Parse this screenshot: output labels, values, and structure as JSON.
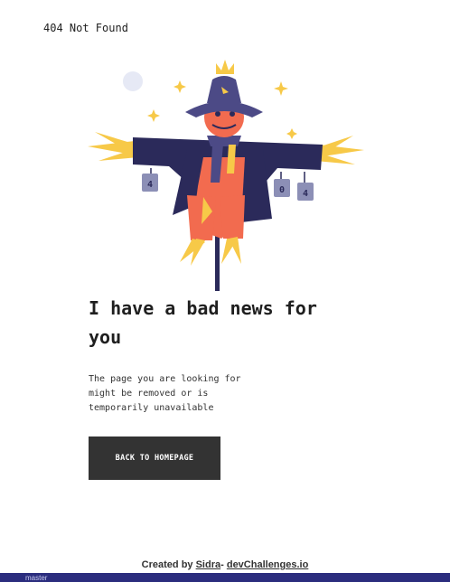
{
  "header": {
    "site_title": "404 Not Found"
  },
  "illustration": {
    "can_labels": [
      "4",
      "0",
      "4"
    ]
  },
  "main": {
    "headline_line1": "I have a bad news for",
    "headline_line2": "you",
    "message_line1": "The page you are looking for",
    "message_line2": "might be removed or is",
    "message_line3": "temporarily unavailable",
    "button_label": "BACK TO HOMEPAGE"
  },
  "footer": {
    "prefix": "Created by",
    "author": "Sidra",
    "separator": "-",
    "site": "devChallenges.io"
  },
  "taskbar": {
    "branch": "master"
  },
  "colors": {
    "hat": "#4c4a86",
    "coat": "#2b2a5a",
    "face": "#f26b4f",
    "straw": "#f7c948",
    "button_bg": "#333333"
  }
}
